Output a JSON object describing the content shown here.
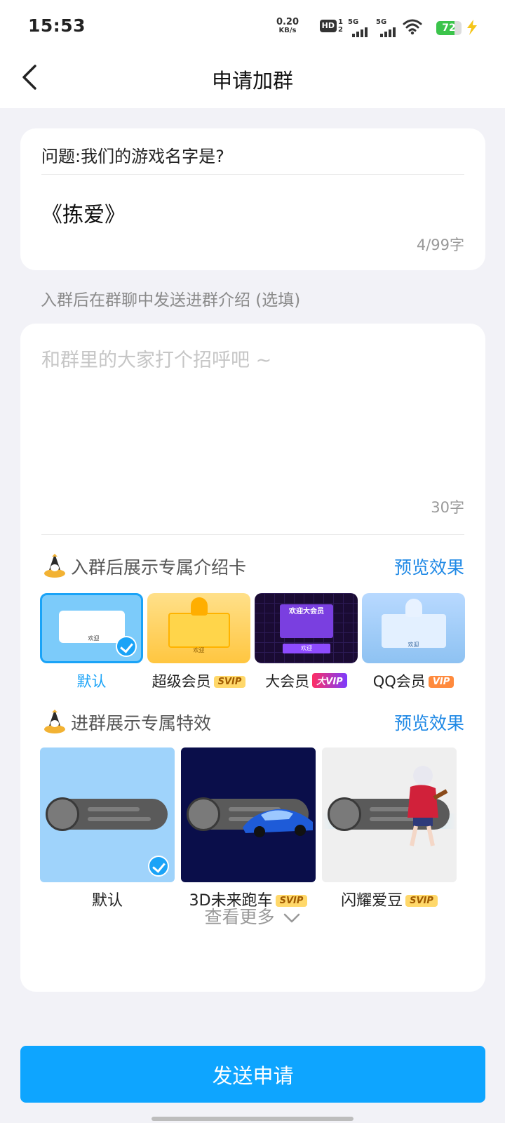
{
  "status_bar": {
    "time": "15:53",
    "net_speed_value": "0.20",
    "net_speed_unit": "KB/s",
    "hd": "HD",
    "sim": "1 2",
    "signal1": "5G",
    "signal2": "5G",
    "battery_level": "72",
    "battery_fraction": 0.72,
    "battery_color": "#3BC44B"
  },
  "header": {
    "title": "申请加群",
    "back_icon": "chevron-left-icon"
  },
  "question_card": {
    "question": "问题:我们的游戏名字是?",
    "answer": "《拣爱》",
    "char_count": "4/99字"
  },
  "intro": {
    "section_label": "入群后在群聊中发送进群介绍 (选填)",
    "placeholder": "和群里的大家打个招呼吧 ~",
    "char_count": "30字"
  },
  "intro_card_section": {
    "title": "入群后展示专属介绍卡",
    "preview": "预览效果",
    "icon": "crown-penguin-icon",
    "items": [
      {
        "label": "默认",
        "badge": "",
        "selected": true,
        "thumb_text": "欢迎"
      },
      {
        "label": "超级会员",
        "badge": "SVIP",
        "selected": false,
        "thumb_text": "欢迎"
      },
      {
        "label": "大会员",
        "badge": "大VIP",
        "selected": false,
        "thumb_text": "欢迎大会员",
        "thumb_button": "欢迎"
      },
      {
        "label": "QQ会员",
        "badge": "VIP",
        "selected": false,
        "thumb_text": "欢迎"
      }
    ]
  },
  "effect_section": {
    "title": "进群展示专属特效",
    "preview": "预览效果",
    "icon": "crown-penguin-icon",
    "items": [
      {
        "label": "默认",
        "badge": "",
        "selected": true
      },
      {
        "label": "3D未来跑车",
        "badge": "SVIP",
        "selected": false
      },
      {
        "label": "闪耀爱豆",
        "badge": "SVIP",
        "selected": false
      }
    ],
    "more": "查看更多"
  },
  "submit": {
    "label": "发送申请",
    "color": "#0EA5FF"
  },
  "colors": {
    "accent": "#1AA3F7",
    "link": "#1E88E5",
    "page_bg": "#F2F2F7"
  }
}
